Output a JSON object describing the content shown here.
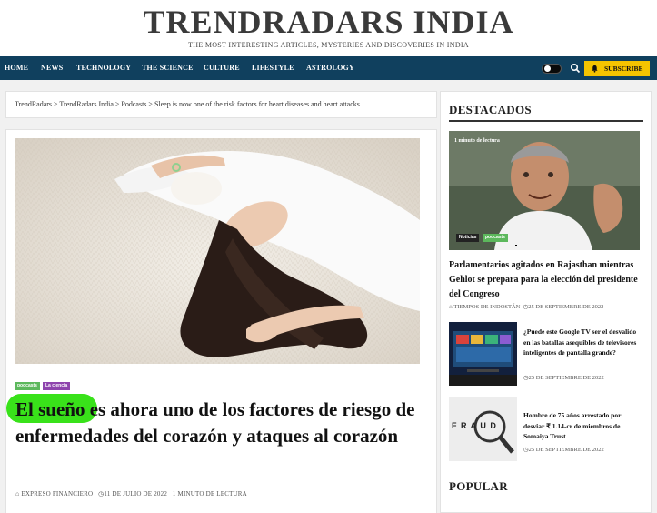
{
  "site": {
    "title": "TRENDRADARS INDIA",
    "tagline": "THE MOST INTERESTING ARTICLES, MYSTERIES AND DISCOVERIES IN INDIA"
  },
  "nav": {
    "items": [
      "HOME",
      "NEWS",
      "TECHNOLOGY",
      "THE SCIENCE",
      "CULTURE",
      "LIFESTYLE",
      "ASTROLOGY"
    ],
    "subscribe_label": "SUBSCRIBE"
  },
  "breadcrumb": {
    "items": [
      "TrendRadars",
      "TrendRadars India",
      "Podcasts",
      "Sleep is now one of the risk factors for heart diseases and heart attacks"
    ],
    "separator": ">"
  },
  "article": {
    "tags": [
      {
        "label": "podcasts",
        "color": "#5cb85c"
      },
      {
        "label": "La ciencia",
        "color": "#8e44ad"
      }
    ],
    "headline": "El sueño es ahora uno de los factores de riesgo de enfermedades del corazón y ataques al corazón",
    "author": "EXPRESO FINANCIERO",
    "date": "11 DE JULIO DE 2022",
    "read_time": "1 MINUTO DE LECTURA"
  },
  "sidebar": {
    "featured_title": "DESTACADOS",
    "featured": {
      "badge": "1 minuto de lectura",
      "tags": [
        {
          "label": "Noticias",
          "color": "#222222"
        },
        {
          "label": "podcasts",
          "color": "#5cb85c"
        }
      ],
      "title": "Parlamentarios agitados en Rajasthan mientras Gehlot se prepara para la elección del presidente del Congreso",
      "source": "TIEMPOS DE INDOSTÁN",
      "date": "25 DE SEPTIEMBRE DE 2022"
    },
    "list": [
      {
        "title": "¿Puede este Google TV ser el desvalido en las batallas asequibles de televisores inteligentes de pantalla grande?",
        "date": "25 DE SEPTIEMBRE DE 2022"
      },
      {
        "title": "Hombre de 75 años arrestado por desviar ₹ 1.14-cr de miembros de Somaiya Trust",
        "date": "25 DE SEPTIEMBRE DE 2022",
        "thumb_text": "F R A U D"
      }
    ],
    "popular_title": "POPULAR"
  },
  "colors": {
    "nav_bg": "#10405e",
    "subscribe_bg": "#f5c400",
    "highlight": "#39e21a"
  }
}
